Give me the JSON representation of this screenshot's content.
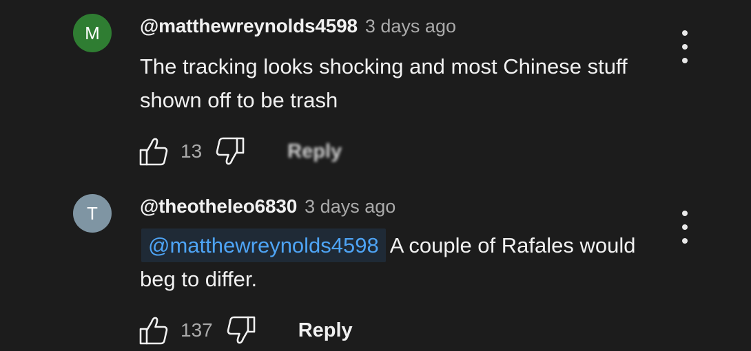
{
  "comments": [
    {
      "avatar_letter": "M",
      "avatar_color": "#2f7d32",
      "author": "@matthewreynolds4598",
      "timestamp": "3 days ago",
      "mention": "",
      "text": "The tracking looks shocking and most Chinese stuff shown off to be trash",
      "like_count": "13",
      "reply_label": "Reply"
    },
    {
      "avatar_letter": "T",
      "avatar_color": "#7f95a3",
      "author": "@theotheleo6830",
      "timestamp": "3 days ago",
      "mention": "@matthewreynolds4598",
      "text": "A couple of Rafales would beg to differ.",
      "like_count": "137",
      "reply_label": "Reply"
    }
  ],
  "icons": {
    "like": "thumbs-up-icon",
    "dislike": "thumbs-down-icon",
    "menu": "more-vertical-icon"
  },
  "colors": {
    "background": "#1c1c1c",
    "text_primary": "#f1f1f1",
    "text_secondary": "#aaaaaa",
    "mention_link": "#4ea4f5"
  }
}
